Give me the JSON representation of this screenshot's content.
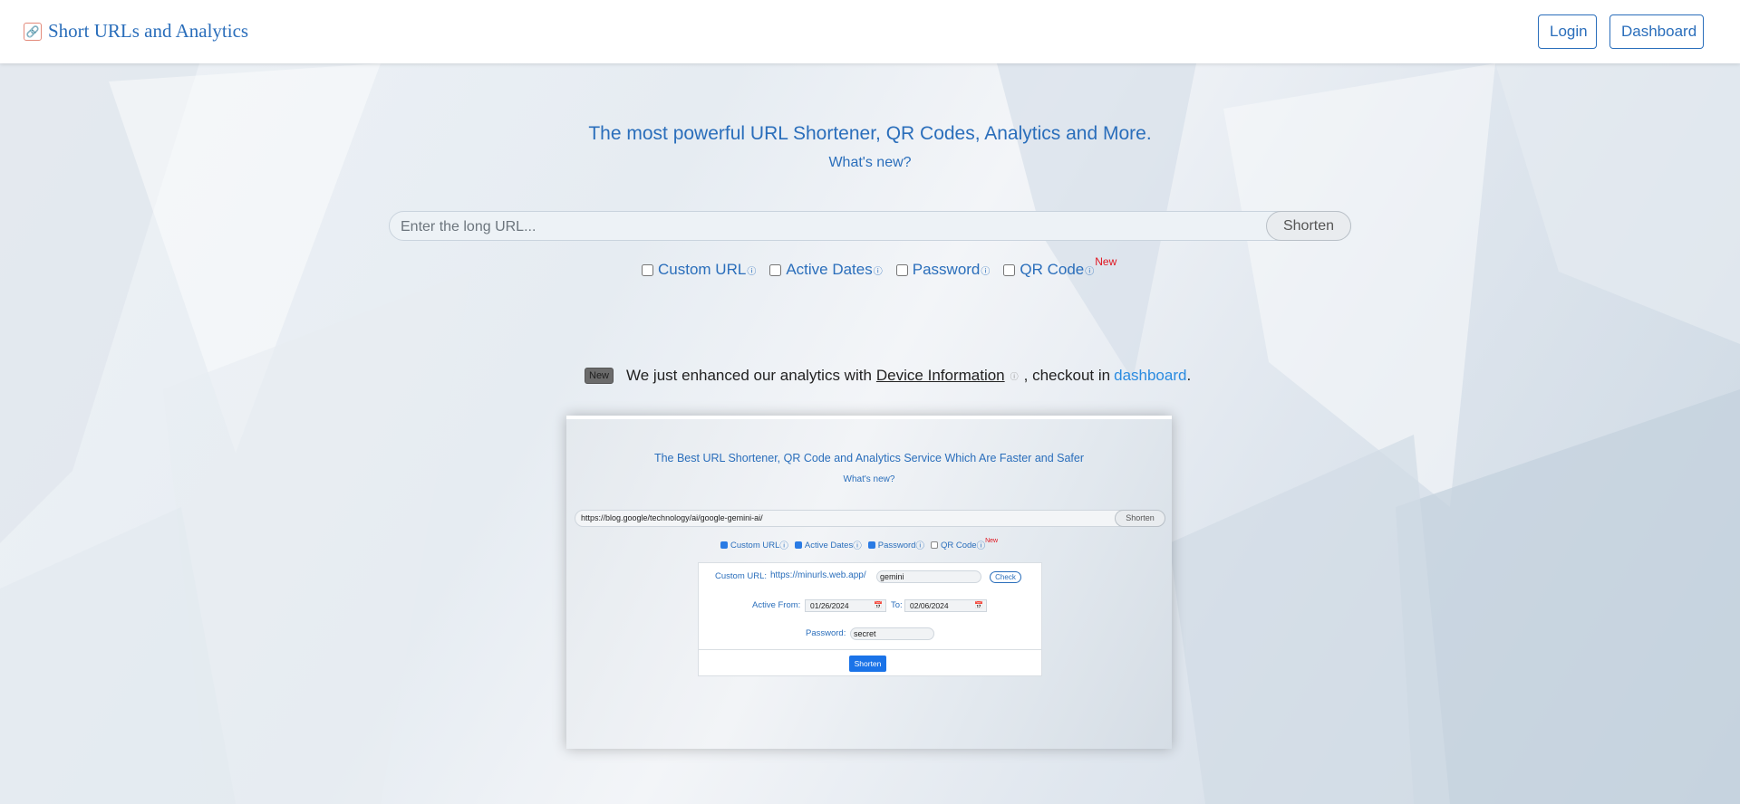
{
  "navbar": {
    "brand": "Short URLs and Analytics",
    "login_label": "Login",
    "dashboard_label": "Dashboard"
  },
  "hero": {
    "headline": "The most powerful URL Shortener, QR Codes, Analytics and More.",
    "whats_new": "What's new?"
  },
  "shortener": {
    "url_value": "",
    "url_placeholder": "Enter the long URL...",
    "shorten_label": "Shorten"
  },
  "options": [
    {
      "label": "Custom URL",
      "checked": false,
      "icon": "info-icon"
    },
    {
      "label": "Active Dates",
      "checked": false,
      "icon": "info-icon"
    },
    {
      "label": "Password",
      "checked": false,
      "icon": "info-icon"
    },
    {
      "label": "QR Code",
      "checked": false,
      "icon": "info-icon",
      "badge": "New"
    }
  ],
  "announcement": {
    "badge": "New",
    "text_before": "We just enhanced our analytics with",
    "link_text": "Device Information",
    "text_middle": ", checkout in",
    "dashboard_link": "dashboard",
    "text_end": "."
  },
  "preview": {
    "headline": "The Best URL Shortener, QR Code and Analytics Service Which Are Faster and Safer",
    "whats_new": "What's new?",
    "url_value": "https://blog.google/technology/ai/google-gemini-ai/",
    "shorten_label": "Shorten",
    "options": [
      {
        "label": "Custom URL",
        "checked": true
      },
      {
        "label": "Active Dates",
        "checked": true
      },
      {
        "label": "Password",
        "checked": true
      },
      {
        "label": "QR Code",
        "checked": false,
        "badge": "New"
      }
    ],
    "custom_url_label": "Custom URL:",
    "custom_url_base": "https://minurls.web.app/",
    "custom_url_value": "gemini",
    "check_label": "Check",
    "active_from_label": "Active From:",
    "active_from_value": "01/26/2024",
    "to_label": "To:",
    "to_value": "02/06/2024",
    "password_label": "Password:",
    "password_value": "secret",
    "submit_label": "Shorten"
  },
  "colors": {
    "accent": "#2a6ebb",
    "link": "#2a8be0",
    "new_badge_red": "#e0141e",
    "primary_button": "#1a73e8"
  }
}
